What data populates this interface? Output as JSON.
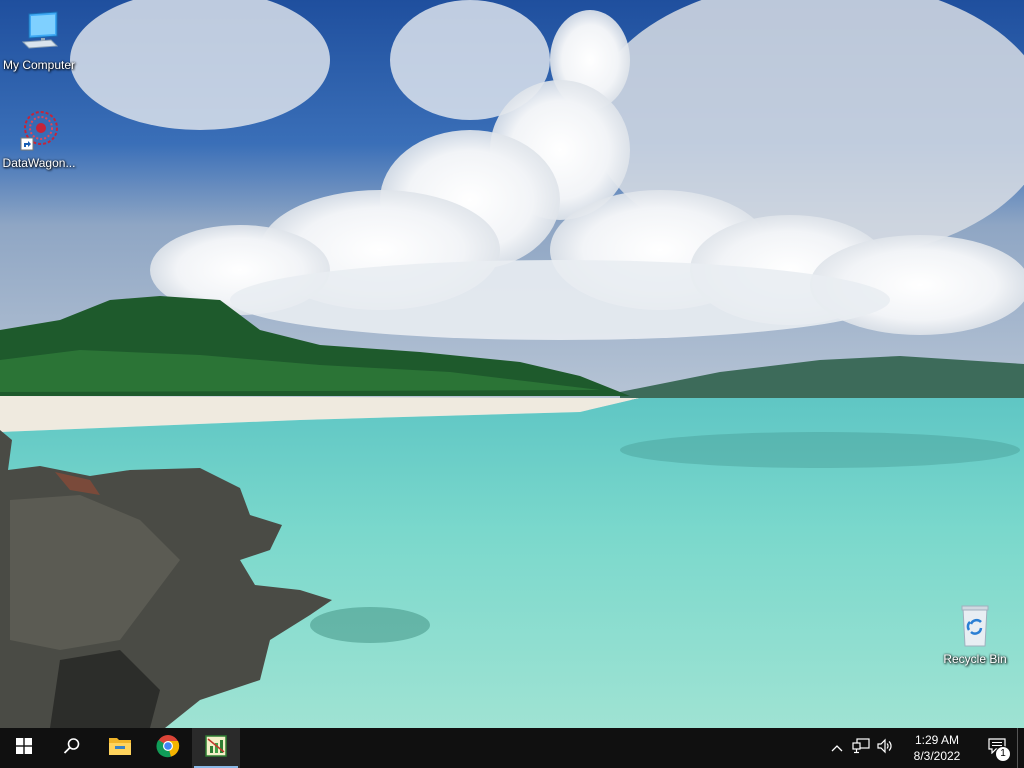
{
  "desktop": {
    "icons": [
      {
        "label": "My Computer",
        "icon": "computer-icon"
      },
      {
        "label": "DataWagon...",
        "icon": "datawagon-icon"
      },
      {
        "label": "Recycle Bin",
        "icon": "recycle-bin-icon"
      }
    ],
    "wallpaper": "tropical-beach-wallpaper"
  },
  "taskbar": {
    "buttons": [
      {
        "icon": "windows-start-icon"
      },
      {
        "icon": "search-icon"
      },
      {
        "icon": "file-explorer-icon"
      },
      {
        "icon": "chrome-icon"
      },
      {
        "icon": "spreadsheet-app-icon",
        "active": true
      }
    ],
    "tray": {
      "icons": [
        "chevron-up-icon",
        "network-icon",
        "volume-icon"
      ],
      "time": "1:29 AM",
      "date": "8/3/2022",
      "notification_count": "1"
    }
  },
  "colors": {
    "taskbar_bg": "#101010",
    "accent": "#8ab8e6"
  }
}
